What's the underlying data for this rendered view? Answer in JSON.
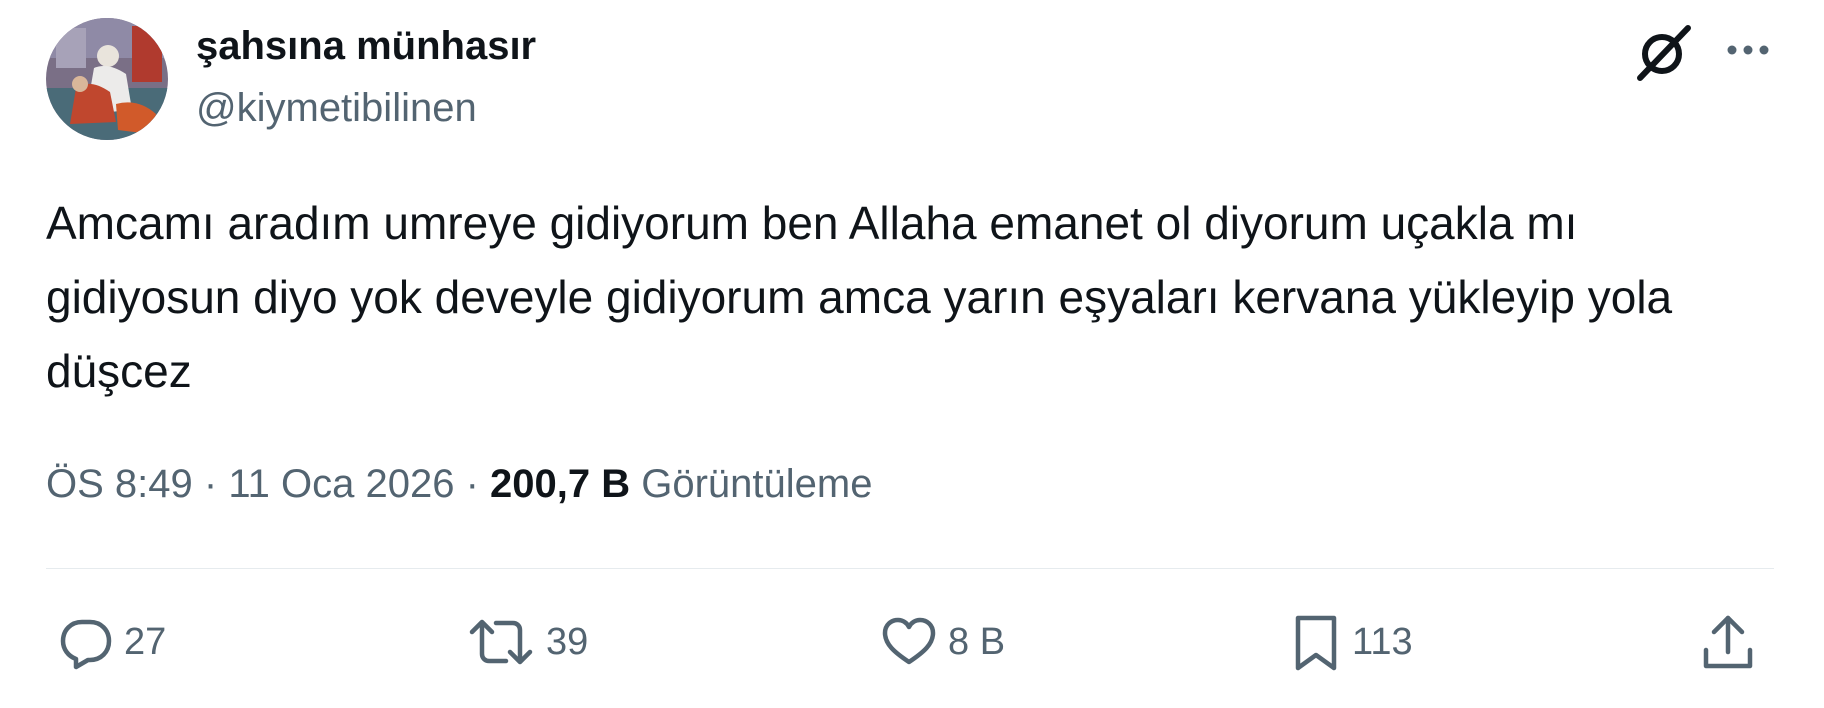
{
  "author": {
    "display_name": "şahsına münhasır",
    "handle": "@kiymetibilinen"
  },
  "tweet": {
    "text": "Amcamı aradım umreye gidiyorum ben Allaha emanet ol diyorum uçakla mı gidiyosun diyo yok deveyle gidiyorum amca yarın eşyaları kervana yükleyip yola düşcez"
  },
  "meta": {
    "time": "ÖS 8:49",
    "separator": "·",
    "date": "11 Oca 2026",
    "views_count": "200,7 B",
    "views_label": "Görüntüleme"
  },
  "actions": {
    "replies": "27",
    "retweets": "39",
    "likes": "8 B",
    "bookmarks": "113"
  },
  "icons": {
    "grok": "grok-icon",
    "more": "more-icon",
    "reply": "reply-icon",
    "retweet": "retweet-icon",
    "like": "heart-icon",
    "bookmark": "bookmark-icon",
    "share": "share-icon"
  },
  "colors": {
    "text_primary": "#0f1419",
    "text_secondary": "#536471",
    "divider": "#e6ebee"
  }
}
